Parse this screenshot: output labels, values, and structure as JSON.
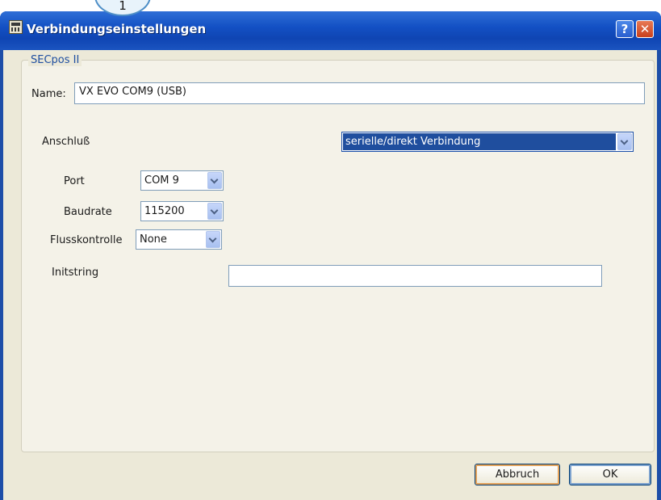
{
  "callout": {
    "number": "1"
  },
  "window": {
    "title": "Verbindungseinstellungen",
    "help_label": "?",
    "close_label": "✕"
  },
  "group": {
    "label": "SECpos II"
  },
  "form": {
    "name_label": "Name:",
    "name_value": "VX EVO COM9 (USB)",
    "anschluss_label": "Anschluß",
    "anschluss_value": "serielle/direkt Verbindung",
    "port_label": "Port",
    "port_value": "COM 9",
    "baudrate_label": "Baudrate",
    "baudrate_value": "115200",
    "flusskontrolle_label": "Flusskontrolle",
    "flusskontrolle_value": "None",
    "initstring_label": "Initstring",
    "initstring_value": ""
  },
  "buttons": {
    "cancel_label": "Abbruch",
    "ok_label": "OK"
  },
  "icons": {
    "app": "terminal-app-icon",
    "help": "question-mark-icon",
    "close": "close-icon",
    "dropdown": "chevron-down-icon"
  },
  "colors": {
    "titlebar": "#1350c4",
    "client_bg": "#ece9d8",
    "group_label": "#1f4fa0",
    "selection": "#1f4e9e",
    "close_button": "#c9401c"
  }
}
